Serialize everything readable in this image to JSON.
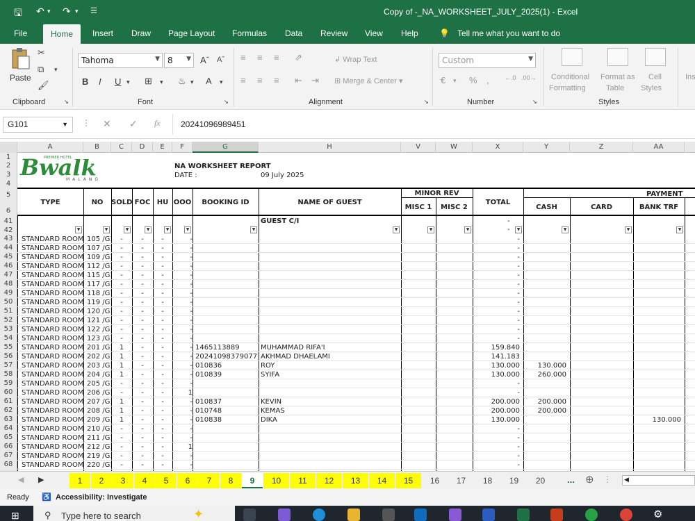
{
  "titlebar": {
    "title": "Copy of -_NA_WORKSHEET_JULY_2025(1)  -  Excel"
  },
  "menu": [
    "File",
    "Home",
    "Insert",
    "Draw",
    "Page Layout",
    "Formulas",
    "Data",
    "Review",
    "View",
    "Help"
  ],
  "tell_me": "Tell me what you want to do",
  "ribbon": {
    "clipboard": {
      "paste": "Paste",
      "label": "Clipboard"
    },
    "font": {
      "name": "Tahoma",
      "size": "8",
      "label": "Font"
    },
    "alignment": {
      "wrap": "Wrap Text",
      "merge": "Merge & Center",
      "label": "Alignment"
    },
    "number": {
      "format": "Custom",
      "label": "Number"
    },
    "styles": {
      "cond1": "Conditional",
      "cond2": "Formatting",
      "fmt1": "Format as",
      "fmt2": "Table",
      "cell1": "Cell",
      "cell2": "Styles",
      "label": "Styles"
    },
    "insert": "Ins"
  },
  "formula_bar": {
    "name_box": "G101",
    "value": "20241096989451"
  },
  "columns": [
    "A",
    "B",
    "C",
    "D",
    "E",
    "F",
    "G",
    "H",
    "V",
    "W",
    "X",
    "Y",
    "Z",
    "AA"
  ],
  "report": {
    "title": "NA WORKSHEET REPORT",
    "date_label": "DATE :",
    "date_value": "09 July 2025"
  },
  "logo": {
    "brand": "Bwalk",
    "tagline": "PREMIER HOTEL",
    "city": "MALANG"
  },
  "headers": {
    "type": "TYPE",
    "no": "NO",
    "sold": "SOLD",
    "foc": "FOC",
    "hu": "HU",
    "ooo": "OOO",
    "booking": "BOOKING ID",
    "guest": "NAME OF GUEST",
    "minor_rev": "MINOR REV",
    "misc1": "MISC 1",
    "misc2": "MISC 2",
    "total": "TOTAL",
    "payment": "PAYMENT",
    "cash": "CASH",
    "card": "CARD",
    "bank": "BANK TRF"
  },
  "guest_ci": "GUEST C/I",
  "row_header_labels": [
    "1",
    "2",
    "3",
    "4",
    "5",
    "6",
    "41",
    "42"
  ],
  "rows": [
    {
      "r": "43",
      "type": "STANDARD ROOM",
      "no": "105 /G1",
      "sold": "-",
      "foc": "-",
      "hu": "-",
      "ooo": "-",
      "booking": "",
      "guest": "",
      "total": "-",
      "cash": "",
      "bank": ""
    },
    {
      "r": "44",
      "type": "STANDARD ROOM",
      "no": "107 /G1",
      "sold": "-",
      "foc": "-",
      "hu": "-",
      "ooo": "-",
      "booking": "",
      "guest": "",
      "total": "-",
      "cash": "",
      "bank": ""
    },
    {
      "r": "45",
      "type": "STANDARD ROOM",
      "no": "109 /G1",
      "sold": "-",
      "foc": "-",
      "hu": "-",
      "ooo": "-",
      "booking": "",
      "guest": "",
      "total": "-",
      "cash": "",
      "bank": ""
    },
    {
      "r": "46",
      "type": "STANDARD ROOM",
      "no": "112 /G1",
      "sold": "-",
      "foc": "-",
      "hu": "-",
      "ooo": "-",
      "booking": "",
      "guest": "",
      "total": "-",
      "cash": "",
      "bank": ""
    },
    {
      "r": "47",
      "type": "STANDARD ROOM",
      "no": "115 /G1",
      "sold": "-",
      "foc": "-",
      "hu": "-",
      "ooo": "-",
      "booking": "",
      "guest": "",
      "total": "-",
      "cash": "",
      "bank": ""
    },
    {
      "r": "48",
      "type": "STANDARD ROOM",
      "no": "117 /G1",
      "sold": "-",
      "foc": "-",
      "hu": "-",
      "ooo": "-",
      "booking": "",
      "guest": "",
      "total": "-",
      "cash": "",
      "bank": ""
    },
    {
      "r": "49",
      "type": "STANDARD ROOM",
      "no": "118 /G1",
      "sold": "-",
      "foc": "-",
      "hu": "-",
      "ooo": "-",
      "booking": "",
      "guest": "",
      "total": "-",
      "cash": "",
      "bank": ""
    },
    {
      "r": "50",
      "type": "STANDARD ROOM",
      "no": "119 /G1",
      "sold": "-",
      "foc": "-",
      "hu": "-",
      "ooo": "-",
      "booking": "",
      "guest": "",
      "total": "-",
      "cash": "",
      "bank": ""
    },
    {
      "r": "51",
      "type": "STANDARD ROOM",
      "no": "120 /G1",
      "sold": "-",
      "foc": "-",
      "hu": "-",
      "ooo": "-",
      "booking": "",
      "guest": "",
      "total": "-",
      "cash": "",
      "bank": ""
    },
    {
      "r": "52",
      "type": "STANDARD ROOM",
      "no": "121 /G1",
      "sold": "-",
      "foc": "-",
      "hu": "-",
      "ooo": "-",
      "booking": "",
      "guest": "",
      "total": "-",
      "cash": "",
      "bank": ""
    },
    {
      "r": "53",
      "type": "STANDARD ROOM",
      "no": "122 /G1",
      "sold": "-",
      "foc": "-",
      "hu": "-",
      "ooo": "-",
      "booking": "",
      "guest": "",
      "total": "-",
      "cash": "",
      "bank": ""
    },
    {
      "r": "54",
      "type": "STANDARD ROOM",
      "no": "123 /G1",
      "sold": "-",
      "foc": "-",
      "hu": "-",
      "ooo": "-",
      "booking": "",
      "guest": "",
      "total": "-",
      "cash": "",
      "bank": ""
    },
    {
      "r": "55",
      "type": "STANDARD ROOM",
      "no": "201 /G1",
      "sold": "1",
      "foc": "-",
      "hu": "-",
      "ooo": "-",
      "booking": "1465113889",
      "guest": "MUHAMMAD RIFA'I",
      "total": "159.840",
      "cash": "",
      "bank": ""
    },
    {
      "r": "56",
      "type": "STANDARD ROOM",
      "no": "202 /G1",
      "sold": "1",
      "foc": "-",
      "hu": "-",
      "ooo": "-",
      "booking": "20241098379077",
      "guest": "AKHMAD DHAELAMI",
      "total": "141.183",
      "cash": "",
      "bank": ""
    },
    {
      "r": "57",
      "type": "STANDARD ROOM",
      "no": "203 /G1",
      "sold": "1",
      "foc": "-",
      "hu": "-",
      "ooo": "-",
      "booking": "010836",
      "guest": "ROY",
      "total": "130.000",
      "cash": "130.000",
      "bank": ""
    },
    {
      "r": "58",
      "type": "STANDARD ROOM",
      "no": "204 /G1",
      "sold": "1",
      "foc": "-",
      "hu": "-",
      "ooo": "-",
      "booking": "010839",
      "guest": "SYIFA",
      "total": "130.000",
      "cash": "260.000",
      "bank": ""
    },
    {
      "r": "59",
      "type": "STANDARD ROOM",
      "no": "205 /G1",
      "sold": "-",
      "foc": "-",
      "hu": "-",
      "ooo": "-",
      "booking": "",
      "guest": "",
      "total": "-",
      "cash": "",
      "bank": ""
    },
    {
      "r": "60",
      "type": "STANDARD ROOM",
      "no": "206 /G1",
      "sold": "-",
      "foc": "-",
      "hu": "-",
      "ooo": "1",
      "booking": "",
      "guest": "",
      "total": "-",
      "cash": "",
      "bank": ""
    },
    {
      "r": "61",
      "type": "STANDARD ROOM",
      "no": "207 /G1",
      "sold": "1",
      "foc": "-",
      "hu": "-",
      "ooo": "-",
      "booking": "010837",
      "guest": "KEVIN",
      "total": "200.000",
      "cash": "200.000",
      "bank": ""
    },
    {
      "r": "62",
      "type": "STANDARD ROOM",
      "no": "208 /G1",
      "sold": "1",
      "foc": "-",
      "hu": "-",
      "ooo": "-",
      "booking": "010748",
      "guest": "KEMAS",
      "total": "200.000",
      "cash": "200.000",
      "bank": ""
    },
    {
      "r": "63",
      "type": "STANDARD ROOM",
      "no": "209 /G1",
      "sold": "1",
      "foc": "-",
      "hu": "-",
      "ooo": "-",
      "booking": "010838",
      "guest": "DIKA",
      "total": "130.000",
      "cash": "",
      "bank": "130.000"
    },
    {
      "r": "64",
      "type": "STANDARD ROOM",
      "no": "210 /G1",
      "sold": "-",
      "foc": "-",
      "hu": "-",
      "ooo": "-",
      "booking": "",
      "guest": "",
      "total": "-",
      "cash": "",
      "bank": ""
    },
    {
      "r": "65",
      "type": "STANDARD ROOM",
      "no": "211 /G1",
      "sold": "-",
      "foc": "-",
      "hu": "-",
      "ooo": "-",
      "booking": "",
      "guest": "",
      "total": "-",
      "cash": "",
      "bank": ""
    },
    {
      "r": "66",
      "type": "STANDARD ROOM",
      "no": "212 /G1",
      "sold": "-",
      "foc": "-",
      "hu": "-",
      "ooo": "1",
      "booking": "",
      "guest": "",
      "total": "-",
      "cash": "",
      "bank": ""
    },
    {
      "r": "67",
      "type": "STANDARD ROOM",
      "no": "219 /G1",
      "sold": "-",
      "foc": "-",
      "hu": "-",
      "ooo": "-",
      "booking": "",
      "guest": "",
      "total": "-",
      "cash": "",
      "bank": ""
    },
    {
      "r": "68",
      "type": "STANDARD ROOM",
      "no": "220 /G1",
      "sold": "-",
      "foc": "-",
      "hu": "-",
      "ooo": "-",
      "booking": "",
      "guest": "",
      "total": "-",
      "cash": "",
      "bank": ""
    }
  ],
  "sheet_tabs": [
    "1",
    "2",
    "3",
    "4",
    "5",
    "6",
    "7",
    "8",
    "9",
    "10",
    "11",
    "12",
    "13",
    "14",
    "15",
    "16",
    "17",
    "18",
    "19",
    "20"
  ],
  "sheet_more": "...",
  "status": {
    "ready": "Ready",
    "accessibility": "Accessibility: Investigate"
  },
  "taskbar": {
    "search": "Type here to search"
  },
  "colors": {
    "excel_green": "#1e7145",
    "tab_yellow": "#ffff00"
  }
}
